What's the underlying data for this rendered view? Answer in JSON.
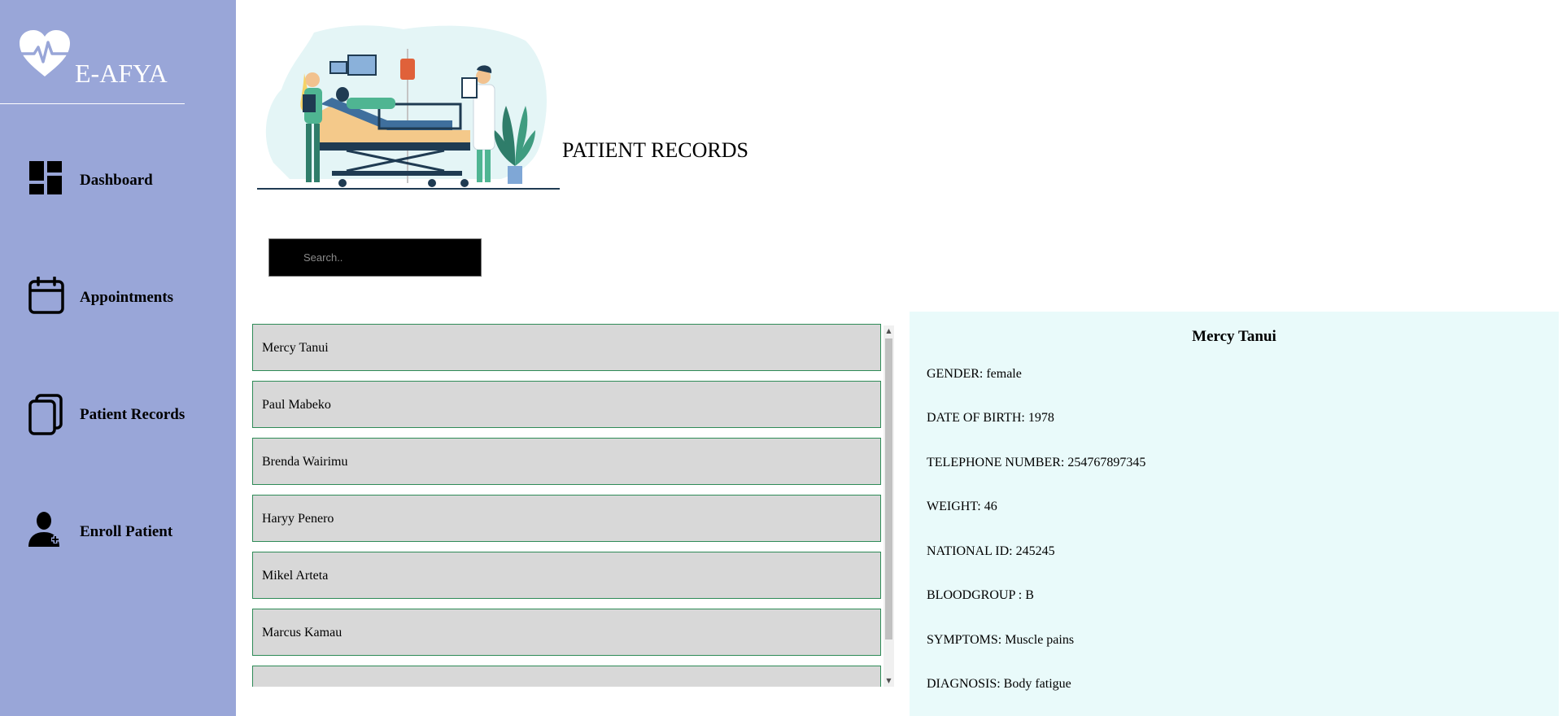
{
  "app": {
    "name": "E-AFYA"
  },
  "sidebar": {
    "items": [
      {
        "label": "Dashboard",
        "icon": "dashboard-icon"
      },
      {
        "label": "Appointments",
        "icon": "calendar-icon"
      },
      {
        "label": "Patient Records",
        "icon": "records-icon"
      },
      {
        "label": "Enroll Patient",
        "icon": "add-user-icon"
      }
    ]
  },
  "header": {
    "title": "PATIENT RECORDS"
  },
  "search": {
    "placeholder": "Search.."
  },
  "patients": [
    "Mercy Tanui",
    "Paul Mabeko",
    "Brenda Wairimu",
    "Haryy Penero",
    "Mikel Arteta",
    "Marcus Kamau",
    ""
  ],
  "details": {
    "name": "Mercy Tanui",
    "rows": [
      "GENDER: female",
      "DATE OF BIRTH: 1978",
      "TELEPHONE NUMBER: 254767897345",
      "WEIGHT: 46",
      "NATIONAL ID: 245245",
      "BLOODGROUP : B",
      "SYMPTOMS: Muscle pains",
      "DIAGNOSIS: Body fatigue"
    ]
  },
  "colors": {
    "sidebar": "#99a6d8",
    "details_bg": "#e9fafa",
    "item_bg": "#d8d8d8",
    "item_border": "#2e8b57"
  }
}
